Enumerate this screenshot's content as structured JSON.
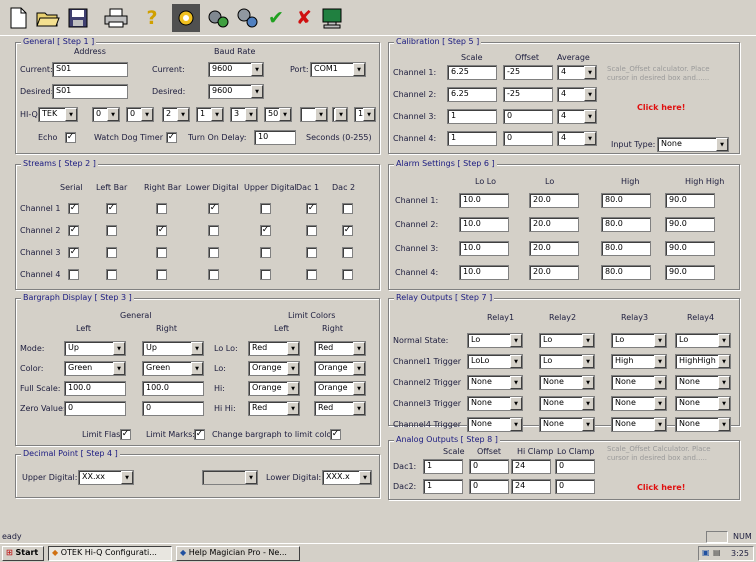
{
  "toolbar": {
    "icons": [
      "new-file-icon",
      "open-folder-icon",
      "save-disk-icon",
      "print-icon",
      "help-question-icon",
      "settings-chip-icon",
      "port-gears-icon",
      "transfer-gears-icon",
      "confirm-check-icon",
      "cancel-x-icon",
      "monitor-icon"
    ]
  },
  "general": {
    "legend": "General [ Step 1 ]",
    "address_header": "Address",
    "baud_header": "Baud Rate",
    "current_label": "Current:",
    "desired_label": "Desired:",
    "current_address": "S01",
    "desired_address": "S01",
    "current_baud_label": "Current:",
    "desired_baud_label": "Desired:",
    "current_baud": "9600",
    "desired_baud": "9600",
    "port_label": "Port:",
    "port": "COM1",
    "hiq_label": "HI-Q",
    "hiq_values": [
      "TEK",
      "0",
      "0",
      "2",
      "1",
      "3",
      "50",
      "",
      ""
    ],
    "hiq_last": "1",
    "echo_label": "Echo",
    "watchdog_label": "Watch Dog Timer",
    "turn_on_label": "Turn On Delay:",
    "turn_on_delay": "10",
    "seconds_label": "Seconds (0-255)"
  },
  "streams": {
    "legend": "Streams [ Step 2 ]",
    "headers": [
      "Serial",
      "Left Bar",
      "Right Bar",
      "Lower Digital",
      "Upper Digital",
      "Dac 1",
      "Dac 2"
    ],
    "rows": [
      {
        "label": "Channel 1",
        "checks": [
          true,
          true,
          false,
          true,
          false,
          true,
          false
        ]
      },
      {
        "label": "Channel 2",
        "checks": [
          true,
          false,
          true,
          false,
          true,
          false,
          true
        ]
      },
      {
        "label": "Channel 3",
        "checks": [
          true,
          false,
          false,
          false,
          false,
          false,
          false
        ]
      },
      {
        "label": "Channel 4",
        "checks": [
          false,
          false,
          false,
          false,
          false,
          false,
          false
        ]
      }
    ]
  },
  "bargraph": {
    "legend": "Bargraph Display [ Step 3 ]",
    "general_header": "General",
    "limit_header": "Limit Colors",
    "left_header": "Left",
    "right_header": "Right",
    "limit_left_header": "Left",
    "limit_right_header": "Right",
    "rows": [
      {
        "label": "Mode:",
        "left": "Up",
        "right": "Up",
        "limit_label": "Lo Lo:",
        "limit_left": "Red",
        "limit_right": "Red"
      },
      {
        "label": "Color:",
        "left": "Green",
        "right": "Green",
        "limit_label": "Lo:",
        "limit_left": "Orange",
        "limit_right": "Orange"
      },
      {
        "label": "Full Scale:",
        "left": "100.0",
        "right": "100.0",
        "limit_label": "Hi:",
        "limit_left": "Orange",
        "limit_right": "Orange"
      },
      {
        "label": "Zero Value:",
        "left": "0",
        "right": "0",
        "limit_label": "Hi Hi:",
        "limit_left": "Red",
        "limit_right": "Red"
      }
    ],
    "limit_flash_label": "Limit Flash:",
    "limit_marks_label": "Limit Marks:",
    "change_color_label": "Change bargraph to limit color"
  },
  "decimal": {
    "legend": "Decimal Point [ Step 4 ]",
    "upper_label": "Upper Digital:",
    "upper_value": "XX.xx",
    "middle_value": "",
    "lower_label": "Lower Digital:",
    "lower_value": "XXX.x"
  },
  "calibration": {
    "legend": "Calibration [ Step 5 ]",
    "headers": [
      "Scale",
      "Offset",
      "Average"
    ],
    "rows": [
      {
        "label": "Channel 1:",
        "scale": "6.25",
        "offset": "-25",
        "average": "4"
      },
      {
        "label": "Channel 2:",
        "scale": "6.25",
        "offset": "-25",
        "average": "4"
      },
      {
        "label": "Channel 3:",
        "scale": "1",
        "offset": "0",
        "average": "4"
      },
      {
        "label": "Channel 4:",
        "scale": "1",
        "offset": "0",
        "average": "4"
      }
    ],
    "hint": "Scale_Offset calculator. Place cursor in desired box and......",
    "click_here": "Click here!",
    "input_type_label": "Input Type:",
    "input_type": "None"
  },
  "alarm": {
    "legend": "Alarm Settings [ Step 6 ]",
    "headers": [
      "Lo Lo",
      "Lo",
      "High",
      "High High"
    ],
    "rows": [
      {
        "label": "Channel 1:",
        "values": [
          "10.0",
          "20.0",
          "80.0",
          "90.0"
        ]
      },
      {
        "label": "Channel 2:",
        "values": [
          "10.0",
          "20.0",
          "80.0",
          "90.0"
        ]
      },
      {
        "label": "Channel 3:",
        "values": [
          "10.0",
          "20.0",
          "80.0",
          "90.0"
        ]
      },
      {
        "label": "Channel 4:",
        "values": [
          "10.0",
          "20.0",
          "80.0",
          "90.0"
        ]
      }
    ]
  },
  "relay": {
    "legend": "Relay Outputs [ Step 7 ]",
    "headers": [
      "Relay1",
      "Relay2",
      "Relay3",
      "Relay4"
    ],
    "rows": [
      {
        "label": "Normal State:",
        "values": [
          "Lo",
          "Lo",
          "Lo",
          "Lo"
        ]
      },
      {
        "label": "Channel1 Trigger",
        "values": [
          "LoLo",
          "Lo",
          "High",
          "HighHigh"
        ]
      },
      {
        "label": "Channel2 Trigger",
        "values": [
          "None",
          "None",
          "None",
          "None"
        ]
      },
      {
        "label": "Channel3 Trigger",
        "values": [
          "None",
          "None",
          "None",
          "None"
        ]
      },
      {
        "label": "Channel4 Trigger",
        "values": [
          "None",
          "None",
          "None",
          "None"
        ]
      }
    ]
  },
  "analog": {
    "legend": "Analog Outputs [ Step 8 ]",
    "headers": [
      "Scale",
      "Offset",
      "Hi Clamp",
      "Lo Clamp"
    ],
    "rows": [
      {
        "label": "Dac1:",
        "values": [
          "1",
          "0",
          "24",
          "0"
        ]
      },
      {
        "label": "Dac2:",
        "values": [
          "1",
          "0",
          "24",
          "0"
        ]
      }
    ],
    "hint": "Scale_Offset Calculator. Place cursor in desired box and.....",
    "click_here": "Click here!"
  },
  "status": {
    "text": "eady",
    "num": "NUM"
  },
  "taskbar": {
    "start": "Start",
    "items": [
      "OTEK Hi-Q Configurati...",
      "Help Magician Pro - Ne..."
    ],
    "clock": "3:25"
  }
}
